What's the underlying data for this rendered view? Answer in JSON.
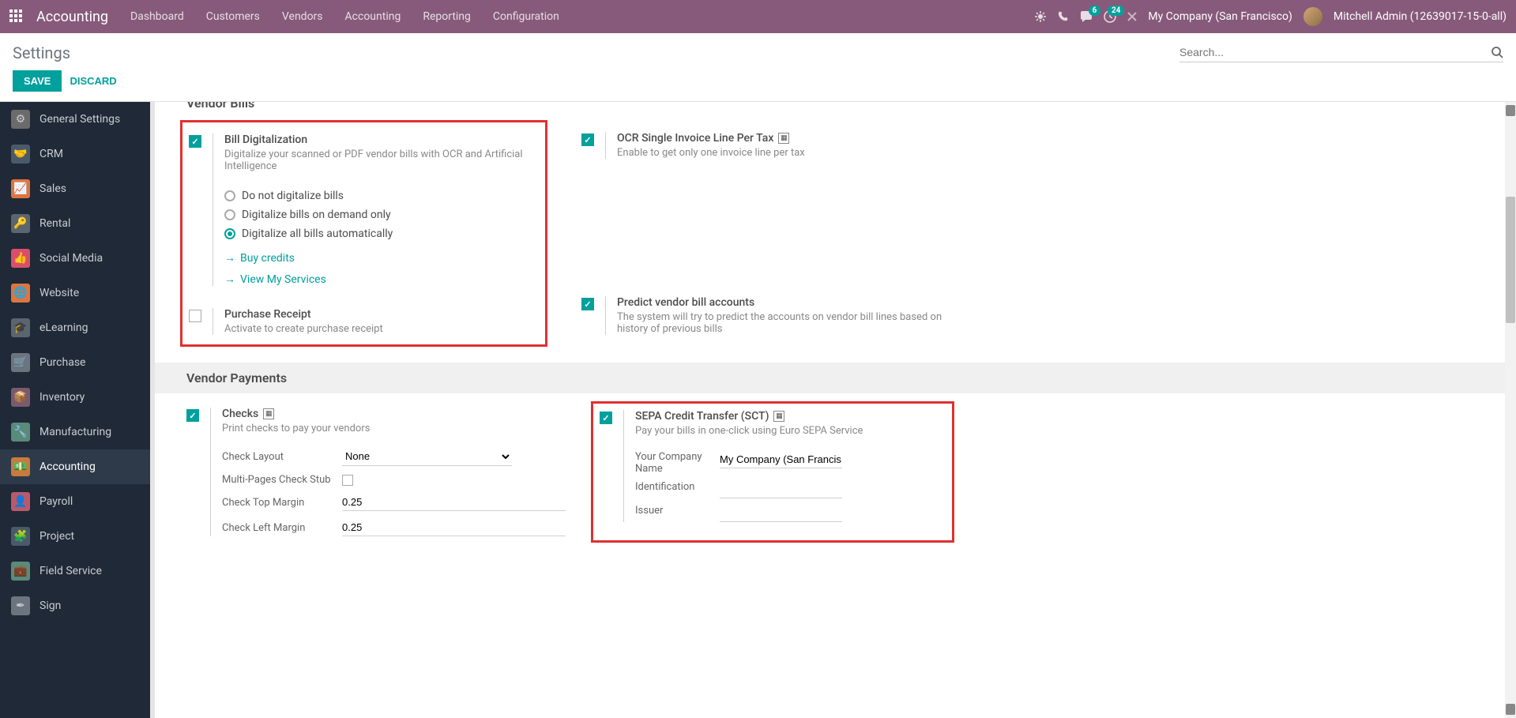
{
  "navbar": {
    "app_name": "Accounting",
    "menu": [
      "Dashboard",
      "Customers",
      "Vendors",
      "Accounting",
      "Reporting",
      "Configuration"
    ],
    "messages_badge": "6",
    "activities_badge": "24",
    "company": "My Company (San Francisco)",
    "user": "Mitchell Admin (12639017-15-0-all)"
  },
  "cp": {
    "title": "Settings",
    "search_placeholder": "Search...",
    "save": "SAVE",
    "discard": "DISCARD"
  },
  "sidebar": {
    "items": [
      {
        "label": "General Settings"
      },
      {
        "label": "CRM"
      },
      {
        "label": "Sales"
      },
      {
        "label": "Rental"
      },
      {
        "label": "Social Media"
      },
      {
        "label": "Website"
      },
      {
        "label": "eLearning"
      },
      {
        "label": "Purchase"
      },
      {
        "label": "Inventory"
      },
      {
        "label": "Manufacturing"
      },
      {
        "label": "Accounting"
      },
      {
        "label": "Payroll"
      },
      {
        "label": "Project"
      },
      {
        "label": "Field Service"
      },
      {
        "label": "Sign"
      }
    ]
  },
  "sections": {
    "vendor_bills": {
      "header": "Vendor Bills",
      "bill_digit": {
        "title": "Bill Digitalization",
        "desc": "Digitalize your scanned or PDF vendor bills with OCR and Artificial Intelligence",
        "opt1": "Do not digitalize bills",
        "opt2": "Digitalize bills on demand only",
        "opt3": "Digitalize all bills automatically",
        "link1": "Buy credits",
        "link2": "View My Services"
      },
      "ocr": {
        "title": "OCR Single Invoice Line Per Tax",
        "desc": "Enable to get only one invoice line per tax"
      },
      "purchase_receipt": {
        "title": "Purchase Receipt",
        "desc": "Activate to create purchase receipt"
      },
      "predict": {
        "title": "Predict vendor bill accounts",
        "desc": "The system will try to predict the accounts on vendor bill lines based on history of previous bills"
      }
    },
    "vendor_payments": {
      "header": "Vendor Payments",
      "checks": {
        "title": "Checks",
        "desc": "Print checks to pay your vendors",
        "layout_label": "Check Layout",
        "layout_value": "None",
        "multipage_label": "Multi-Pages Check Stub",
        "top_margin_label": "Check Top Margin",
        "top_margin_value": "0.25",
        "left_margin_label": "Check Left Margin",
        "left_margin_value": "0.25"
      },
      "sepa": {
        "title": "SEPA Credit Transfer (SCT)",
        "desc": "Pay your bills in one-click using Euro SEPA Service",
        "company_label": "Your Company Name",
        "company_value": "My Company (San Francis",
        "ident_label": "Identification",
        "issuer_label": "Issuer"
      }
    }
  }
}
